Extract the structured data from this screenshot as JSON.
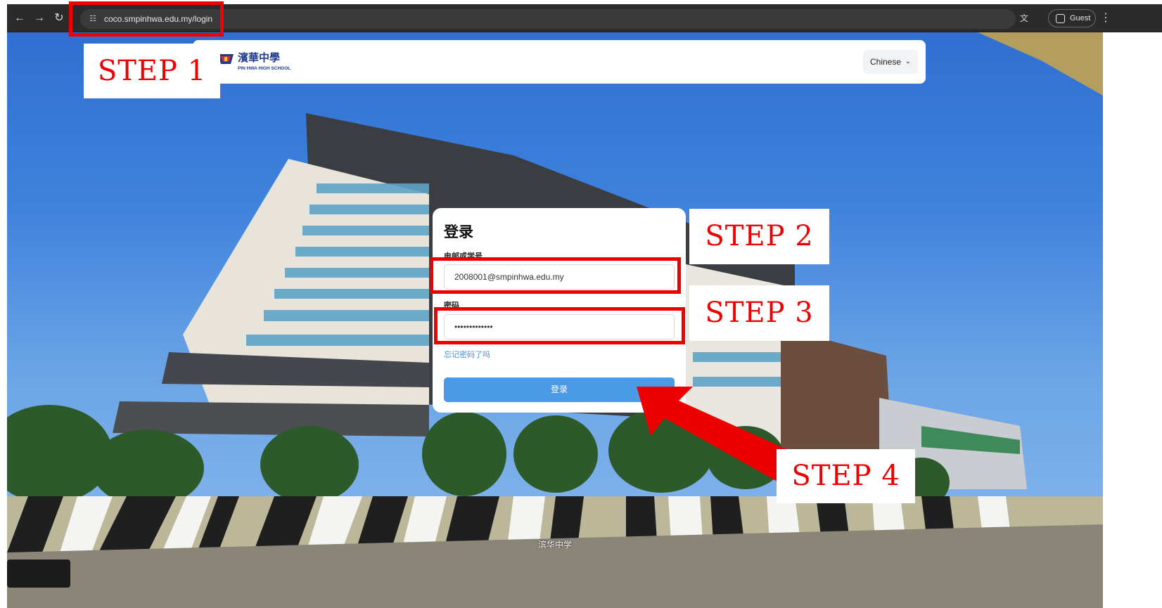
{
  "browser": {
    "url": "coco.smpinhwa.edu.my/login",
    "profile_label": "Guest",
    "back_icon": "←",
    "forward_icon": "→",
    "reload_icon": "↻",
    "site_info_icon": "☷",
    "translate_icon": "文",
    "menu_icon": "⋮"
  },
  "header": {
    "logo_title": "濱華中學",
    "logo_subtitle": "PIN HWA HIGH SCHOOL",
    "language_selected": "Chinese",
    "language_chevron": "⌄"
  },
  "login": {
    "title": "登录",
    "email_label": "电邮或学号",
    "email_value": "2008001@smpinhwa.edu.my",
    "password_label": "密码",
    "password_value": "•••••••••••••",
    "forgot_link": "忘记密码了吗",
    "submit_label": "登录"
  },
  "page": {
    "footer_caption": "滨华中学"
  },
  "annotations": {
    "step1": "STEP 1",
    "step2": "STEP 2",
    "step3": "STEP 3",
    "step4": "STEP 4",
    "highlight_color": "#ee0000"
  },
  "colors": {
    "primary_button": "#4b9ae6",
    "link": "#4a90d9",
    "browser_bar": "#2b2b2b"
  }
}
